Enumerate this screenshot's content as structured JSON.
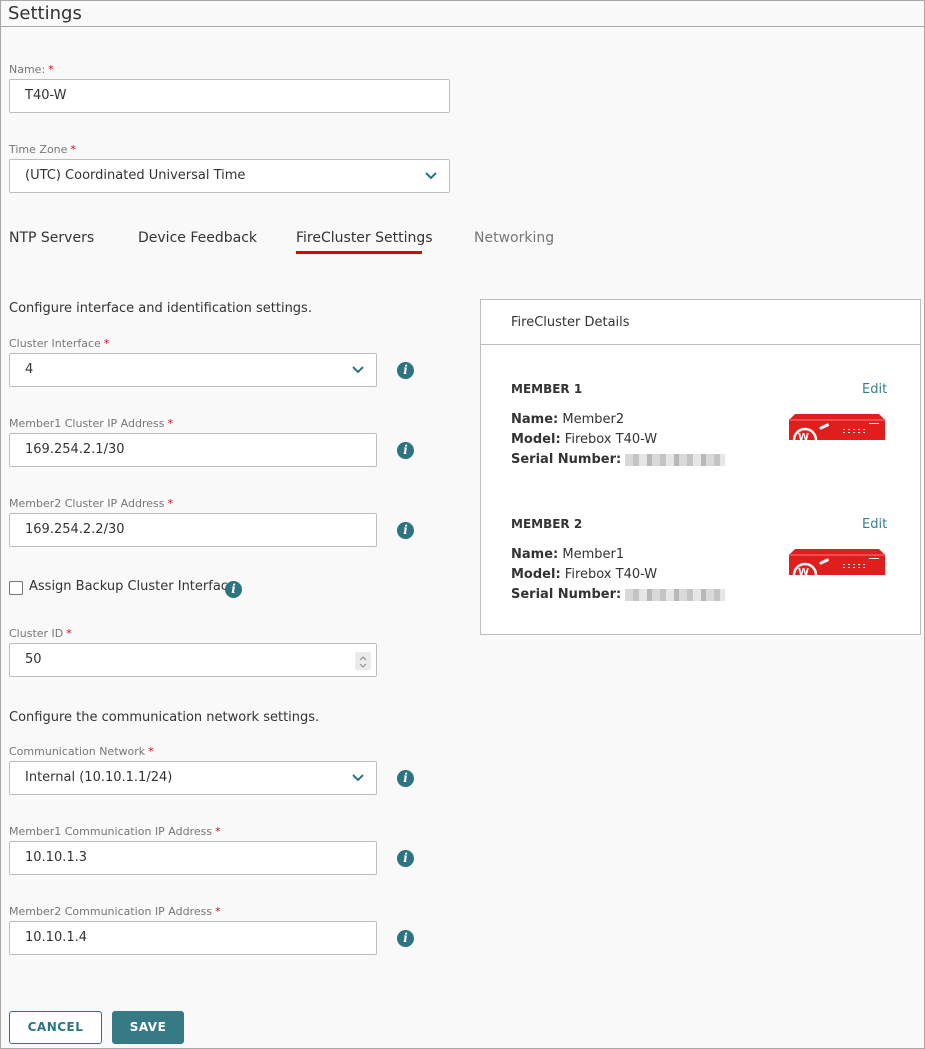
{
  "header": {
    "title": "Settings"
  },
  "general": {
    "name_label": "Name:",
    "name_value": "T40-W",
    "timezone_label": "Time Zone",
    "timezone_value": "(UTC) Coordinated Universal Time",
    "required_mark": "*"
  },
  "tabs": [
    {
      "label": "NTP Servers",
      "active": false
    },
    {
      "label": "Device Feedback",
      "active": false
    },
    {
      "label": "FireCluster Settings",
      "active": true
    },
    {
      "label": "Networking",
      "active": false
    }
  ],
  "cluster": {
    "intro": "Configure interface and identification settings.",
    "interface_label": "Cluster Interface",
    "interface_value": "4",
    "member1_ip_label": "Member1 Cluster IP Address",
    "member1_ip_value": "169.254.2.1/30",
    "member2_ip_label": "Member2 Cluster IP Address",
    "member2_ip_value": "169.254.2.2/30",
    "backup_label": "Assign Backup Cluster Interface",
    "backup_checked": false,
    "cluster_id_label": "Cluster ID",
    "cluster_id_value": "50"
  },
  "communication": {
    "intro": "Configure the communication network settings.",
    "network_label": "Communication Network",
    "network_value": "Internal (10.10.1.1/24)",
    "member1_label": "Member1 Communication IP Address",
    "member1_value": "10.10.1.3",
    "member2_label": "Member2 Communication IP Address",
    "member2_value": "10.10.1.4"
  },
  "details_panel": {
    "title": "FireCluster Details",
    "name_key": "Name:",
    "model_key": "Model:",
    "serial_key": "Serial Number:",
    "edit_label": "Edit",
    "members": [
      {
        "heading": "MEMBER 1",
        "name": "Member2",
        "model": "Firebox T40-W"
      },
      {
        "heading": "MEMBER 2",
        "name": "Member1",
        "model": "Firebox T40-W"
      }
    ]
  },
  "actions": {
    "cancel": "CANCEL",
    "save": "SAVE"
  },
  "colors": {
    "accent": "#2c7480",
    "tab_underline": "#e00000",
    "required": "#d0021b",
    "device_red": "#e01e1e"
  }
}
